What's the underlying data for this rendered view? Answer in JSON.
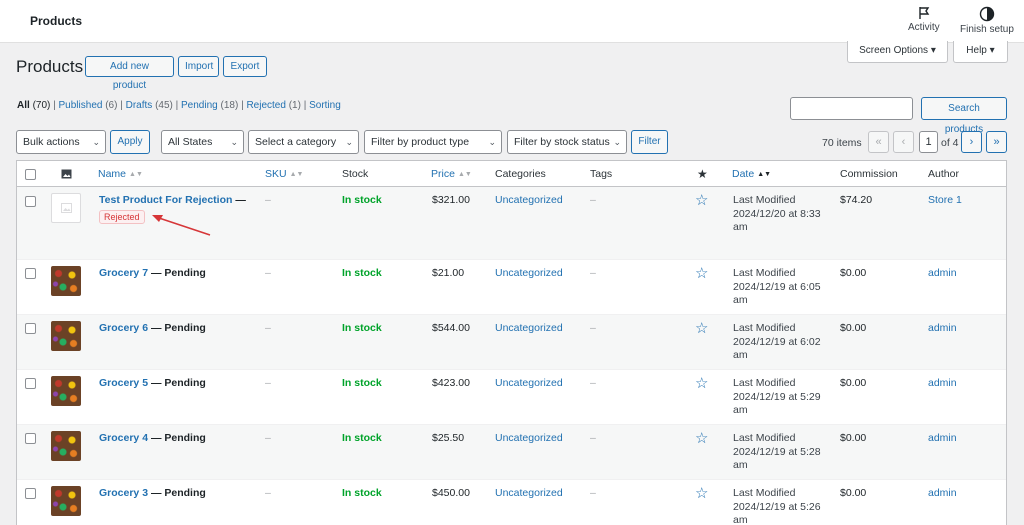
{
  "header": {
    "title": "Products",
    "activity_label": "Activity",
    "finish_setup_label": "Finish setup",
    "screen_options_label": "Screen Options",
    "help_label": "Help"
  },
  "page": {
    "title": "Products",
    "add_new_label": "Add new product",
    "import_label": "Import",
    "export_label": "Export"
  },
  "filters_views": [
    {
      "label": "All",
      "count": "(70)"
    },
    {
      "label": "Published",
      "count": "(6)"
    },
    {
      "label": "Drafts",
      "count": "(45)"
    },
    {
      "label": "Pending",
      "count": "(18)"
    },
    {
      "label": "Rejected",
      "count": "(1)"
    },
    {
      "label": "Sorting",
      "count": ""
    }
  ],
  "search": {
    "placeholder": "",
    "button_label": "Search products"
  },
  "toolbar": {
    "bulk_actions": "Bulk actions",
    "apply_label": "Apply",
    "states": "All States",
    "category": "Select a category",
    "product_type": "Filter by product type",
    "stock_status": "Filter by stock status",
    "filter_label": "Filter"
  },
  "pagination": {
    "items": "70 items",
    "first": "«",
    "prev": "‹",
    "current": "1",
    "of": "of 4",
    "next": "›",
    "last": "»"
  },
  "columns": {
    "name": "Name",
    "sku": "SKU",
    "stock": "Stock",
    "price": "Price",
    "categories": "Categories",
    "tags": "Tags",
    "featured": "★",
    "date": "Date",
    "commission": "Commission",
    "author": "Author"
  },
  "rows": [
    {
      "name": "Test Product For Rejection",
      "state": "—",
      "badge": "Rejected",
      "sku": "–",
      "stock": "In stock",
      "price": "$321.00",
      "category": "Uncategorized",
      "tags": "–",
      "date_label": "Last Modified",
      "date": "2024/12/20 at 8:33 am",
      "commission": "$74.20",
      "author": "Store 1"
    },
    {
      "name": "Grocery 7",
      "state": "— Pending",
      "sku": "–",
      "stock": "In stock",
      "price": "$21.00",
      "category": "Uncategorized",
      "tags": "–",
      "date_label": "Last Modified",
      "date": "2024/12/19 at 6:05 am",
      "commission": "$0.00",
      "author": "admin"
    },
    {
      "name": "Grocery 6",
      "state": "— Pending",
      "sku": "–",
      "stock": "In stock",
      "price": "$544.00",
      "category": "Uncategorized",
      "tags": "–",
      "date_label": "Last Modified",
      "date": "2024/12/19 at 6:02 am",
      "commission": "$0.00",
      "author": "admin"
    },
    {
      "name": "Grocery 5",
      "state": "— Pending",
      "sku": "–",
      "stock": "In stock",
      "price": "$423.00",
      "category": "Uncategorized",
      "tags": "–",
      "date_label": "Last Modified",
      "date": "2024/12/19 at 5:29 am",
      "commission": "$0.00",
      "author": "admin"
    },
    {
      "name": "Grocery 4",
      "state": "— Pending",
      "sku": "–",
      "stock": "In stock",
      "price": "$25.50",
      "category": "Uncategorized",
      "tags": "–",
      "date_label": "Last Modified",
      "date": "2024/12/19 at 5:28 am",
      "commission": "$0.00",
      "author": "admin"
    },
    {
      "name": "Grocery 3",
      "state": "— Pending",
      "sku": "–",
      "stock": "In stock",
      "price": "$450.00",
      "category": "Uncategorized",
      "tags": "–",
      "date_label": "Last Modified",
      "date": "2024/12/19 at 5:26 am",
      "commission": "$0.00",
      "author": "admin"
    }
  ]
}
